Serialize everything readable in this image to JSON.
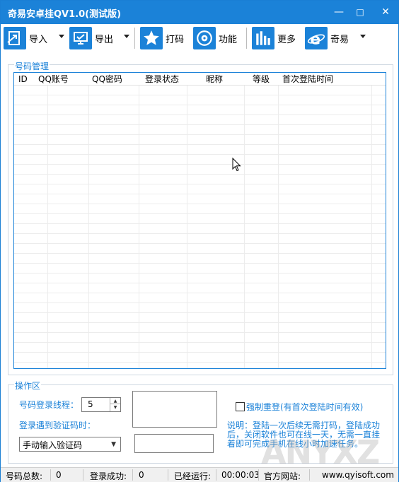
{
  "window": {
    "title": "奇易安卓挂QV1.0(测试版)",
    "minimize_glyph": "—",
    "maximize_glyph": "□",
    "close_glyph": "✕"
  },
  "toolbar": {
    "items": [
      {
        "label": "导入",
        "icon": "import-icon",
        "has_dropdown": true
      },
      {
        "label": "导出",
        "icon": "export-icon",
        "has_dropdown": true
      },
      {
        "label": "打码",
        "icon": "star-icon",
        "has_dropdown": false
      },
      {
        "label": "功能",
        "icon": "disc-icon",
        "has_dropdown": false
      },
      {
        "label": "更多",
        "icon": "bar-chart-icon",
        "has_dropdown": false
      },
      {
        "label": "奇易",
        "icon": "ie-icon",
        "has_dropdown": true
      }
    ]
  },
  "account_panel": {
    "label": "号码管理",
    "columns": [
      "ID",
      "QQ账号",
      "QQ密码",
      "登录状态",
      "昵称",
      "等级",
      "首次登陆时间"
    ]
  },
  "ops_panel": {
    "label": "操作区",
    "threads_label": "号码登录线程：",
    "threads_value": "5",
    "captcha_label": "登录遇到验证码时：",
    "captcha_mode": "手动输入验证码",
    "force_relogin_label": "强制重登(有首次登陆时间有效)",
    "note": "说明：登陆一次后续无需打码，登陆成功后，关闭软件也可在线一天，无需一直挂着即可完成手机在线小时加速任务。"
  },
  "statusbar": {
    "total_label": "号码总数:",
    "total_value": "0",
    "success_label": "登录成功:",
    "success_value": "0",
    "running_label": "已经运行:",
    "running_value": "00:00:03",
    "site_label": "官方网站:",
    "site_value": "www.qyisoft.com"
  },
  "colors": {
    "accent": "#1b82d8",
    "titlebar": "#1b82d8"
  }
}
